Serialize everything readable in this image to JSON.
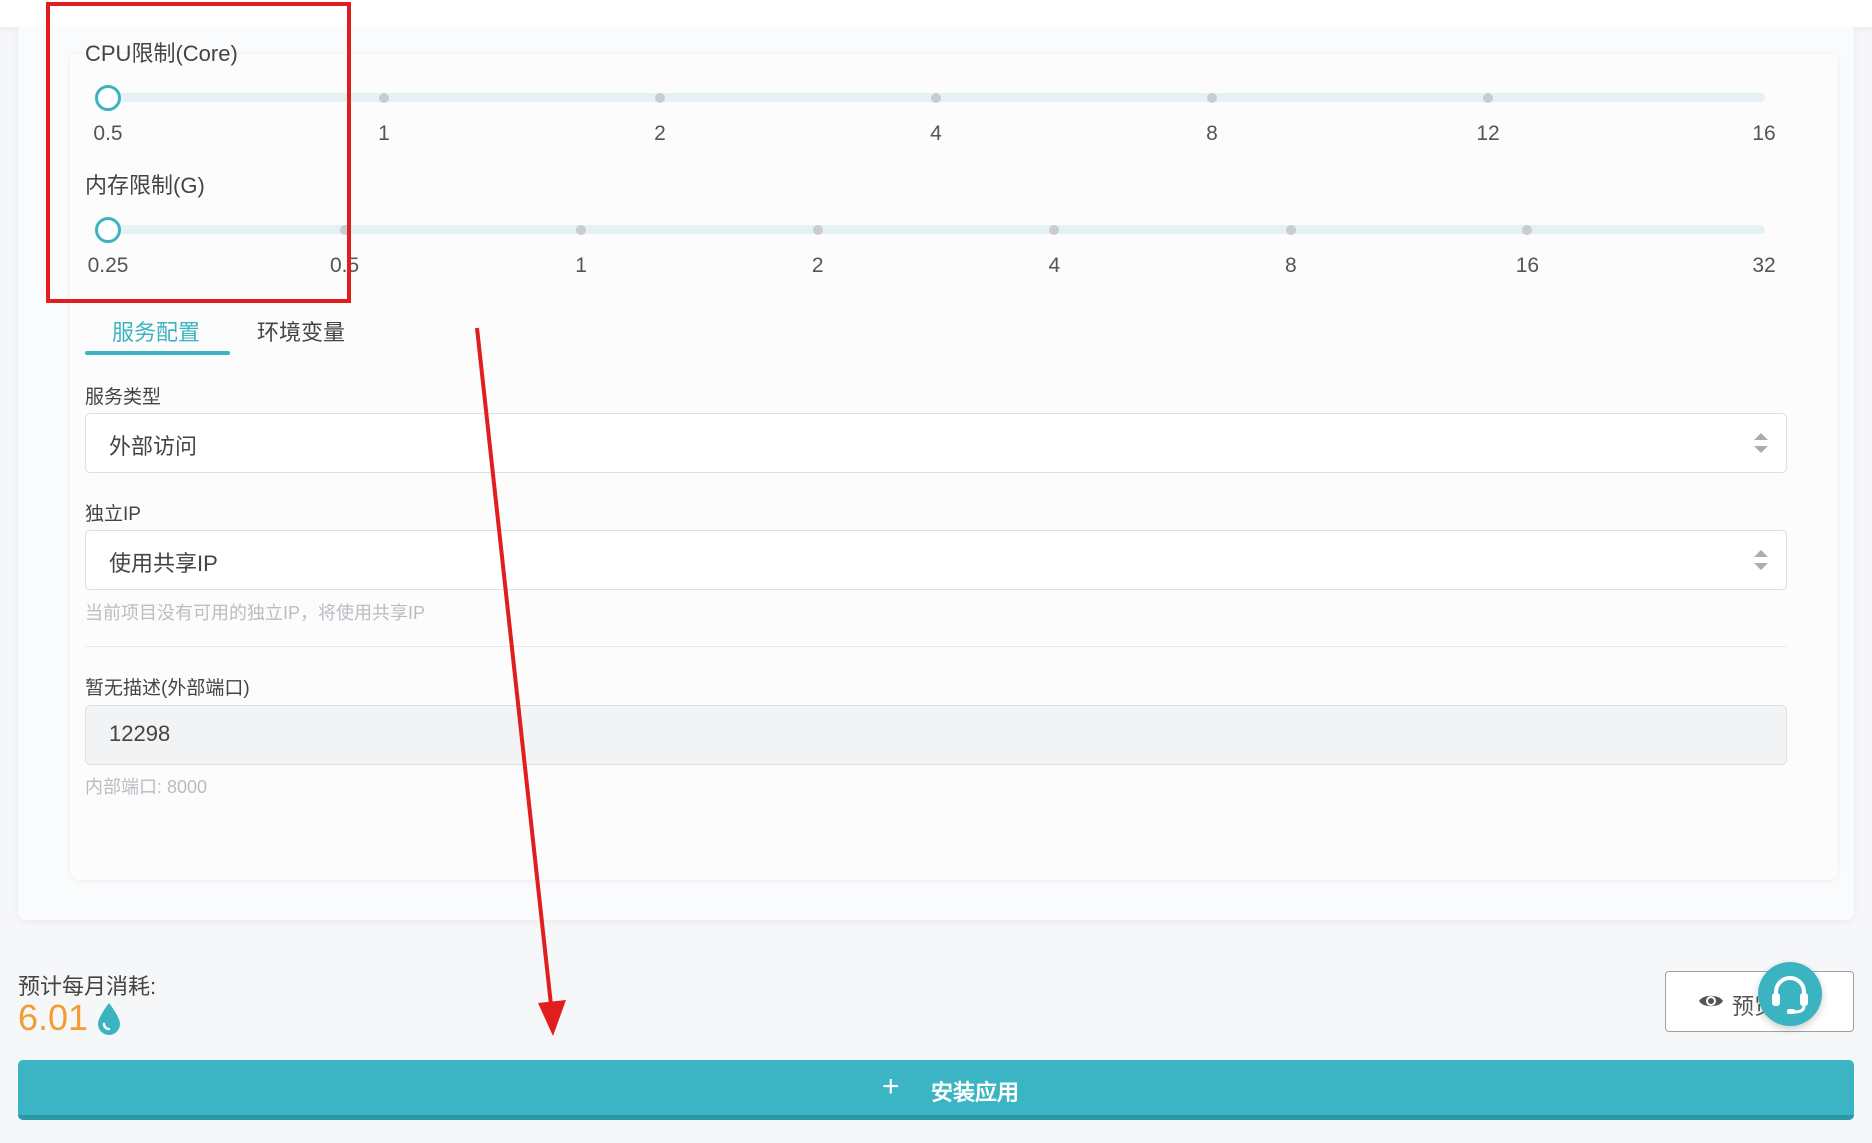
{
  "cpu": {
    "label": "CPU限制(Core)",
    "ticks": [
      "0.5",
      "1",
      "2",
      "4",
      "8",
      "12",
      "16"
    ],
    "selected_index": 0
  },
  "memory": {
    "label": "内存限制(G)",
    "ticks": [
      "0.25",
      "0.5",
      "1",
      "2",
      "4",
      "8",
      "16",
      "32"
    ],
    "selected_index": 0
  },
  "tabs": [
    {
      "label": "服务配置",
      "active": true
    },
    {
      "label": "环境变量",
      "active": false
    }
  ],
  "service_type": {
    "label": "服务类型",
    "value": "外部访问"
  },
  "dedicated_ip": {
    "label": "独立IP",
    "value": "使用共享IP",
    "hint": "当前项目没有可用的独立IP，将使用共享IP"
  },
  "external_port": {
    "label": "暂无描述(外部端口)",
    "value": "12298",
    "hint": "内部端口: 8000"
  },
  "cost": {
    "label": "预计每月消耗:",
    "value": "6.01",
    "icon": "droplet-icon"
  },
  "preview_button": {
    "label": "预览",
    "icon": "eye-icon"
  },
  "install_button": {
    "label": "安装应用",
    "icon": "plus-icon"
  },
  "support_button": {
    "icon": "headset-icon"
  },
  "colors": {
    "accent": "#3cb3c1",
    "cost": "#f39c33",
    "annotation": "#e01e1e"
  }
}
